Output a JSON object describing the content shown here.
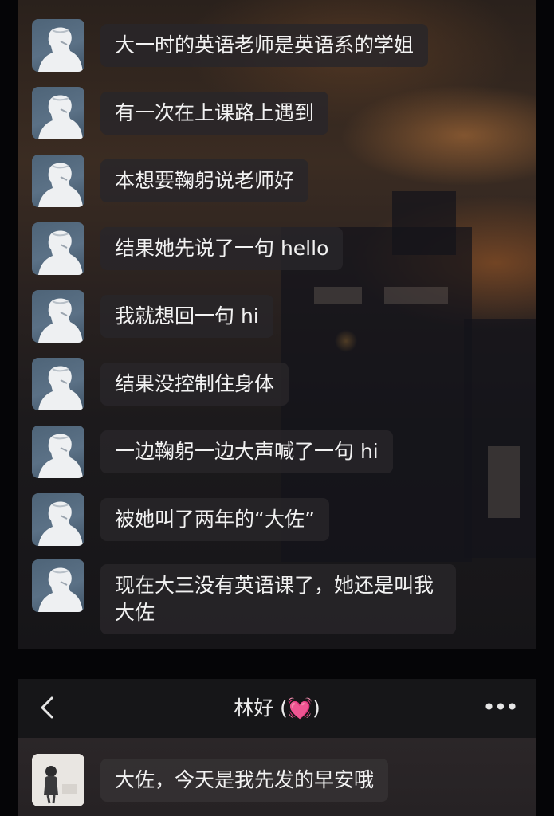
{
  "thread_top": {
    "messages": [
      {
        "text": "大一时的英语老师是英语系的学姐"
      },
      {
        "text": "有一次在上课路上遇到"
      },
      {
        "text": "本想要鞠躬说老师好"
      },
      {
        "text": "结果她先说了一句 hello"
      },
      {
        "text": "我就想回一句 hi"
      },
      {
        "text": "结果没控制住身体"
      },
      {
        "text": "一边鞠躬一边大声喊了一句 hi"
      },
      {
        "text": "被她叫了两年的“大佐”"
      },
      {
        "text": "现在大三没有英语课了，她还是叫我大佐"
      }
    ]
  },
  "thread_bottom": {
    "header": {
      "back_icon": "chevron-left-icon",
      "title_name": "林好",
      "title_open": " (",
      "title_heart": "💓",
      "title_close": ")",
      "more_label": "•••"
    },
    "messages": [
      {
        "text": "大佐，今天是我先发的早安哦"
      }
    ]
  },
  "colors": {
    "bubble_bg": "#28262a",
    "text": "#f2f2f2",
    "avatar_bg": "#4e6478",
    "heart": "#e0559a"
  }
}
